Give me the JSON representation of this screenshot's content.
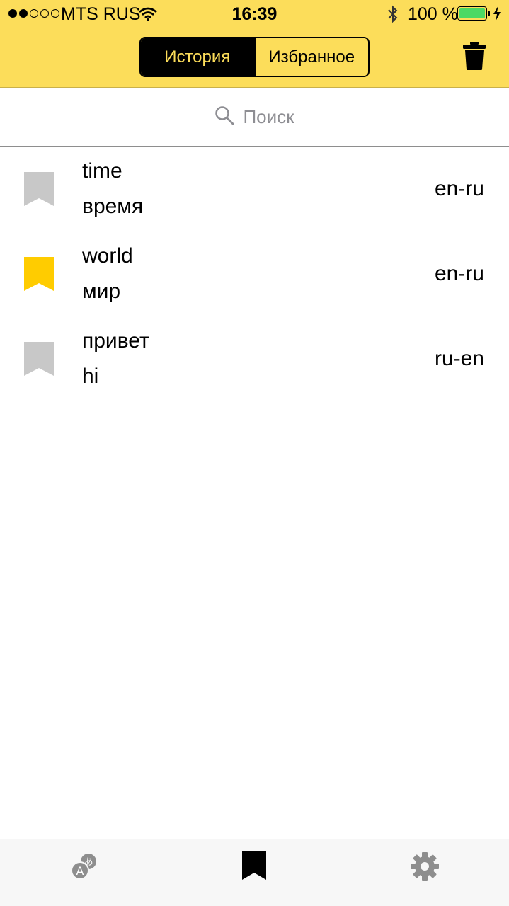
{
  "status_bar": {
    "carrier": "MTS RUS",
    "time": "16:39",
    "battery_percent": "100 %"
  },
  "nav": {
    "segments": [
      "История",
      "Избранное"
    ],
    "active_segment": "История",
    "trash_icon": "trash-icon"
  },
  "search": {
    "placeholder": "Поиск",
    "icon": "search-icon"
  },
  "history": [
    {
      "word": "time",
      "translation": "время",
      "lang": "en-ru",
      "favorite": false
    },
    {
      "word": "world",
      "translation": "мир",
      "lang": "en-ru",
      "favorite": true
    },
    {
      "word": "привет",
      "translation": "hi",
      "lang": "ru-en",
      "favorite": false
    }
  ],
  "tabbar": {
    "tabs": [
      "translate-icon",
      "bookmark-icon",
      "gear-icon"
    ],
    "active_tab": "bookmark-icon"
  },
  "colors": {
    "accent": "#fcdd5a",
    "favorite": "#ffcc00",
    "not_favorite": "#c8c8c8",
    "active_tab": "#000000",
    "inactive_tab": "#8e8e8e"
  }
}
